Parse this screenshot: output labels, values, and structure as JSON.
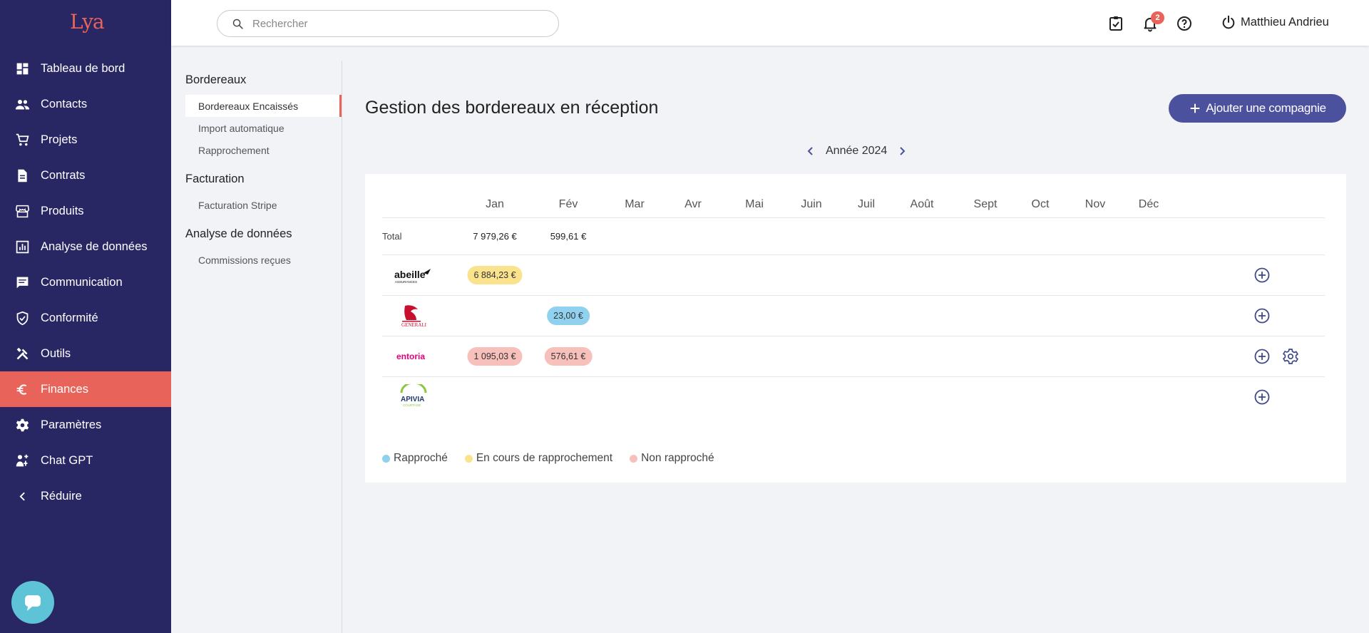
{
  "app": {
    "logo_text": "Lya"
  },
  "sidebar": {
    "items": [
      {
        "label": "Tableau de bord",
        "icon": "dashboard-icon"
      },
      {
        "label": "Contacts",
        "icon": "people-icon"
      },
      {
        "label": "Projets",
        "icon": "cart-icon"
      },
      {
        "label": "Contrats",
        "icon": "document-icon"
      },
      {
        "label": "Produits",
        "icon": "store-icon"
      },
      {
        "label": "Analyse de données",
        "icon": "bar-chart-icon"
      },
      {
        "label": "Communication",
        "icon": "message-icon"
      },
      {
        "label": "Conformité",
        "icon": "shield-check-icon"
      },
      {
        "label": "Outils",
        "icon": "tools-icon"
      },
      {
        "label": "Finances",
        "icon": "euro-icon",
        "active": true
      },
      {
        "label": "Paramètres",
        "icon": "gear-icon"
      },
      {
        "label": "Chat GPT",
        "icon": "robot-icon"
      },
      {
        "label": "Réduire",
        "icon": "chevron-left-icon"
      }
    ]
  },
  "header": {
    "search_placeholder": "Rechercher",
    "notification_count": "2",
    "user_name": "Matthieu Andrieu"
  },
  "submenu": {
    "sections": [
      {
        "title": "Bordereaux",
        "items": [
          {
            "label": "Bordereaux Encaissés",
            "active": true
          },
          {
            "label": "Import automatique"
          },
          {
            "label": "Rapprochement"
          }
        ]
      },
      {
        "title": "Facturation",
        "items": [
          {
            "label": "Facturation Stripe"
          }
        ]
      },
      {
        "title": "Analyse de données",
        "items": [
          {
            "label": "Commissions reçues"
          }
        ]
      }
    ]
  },
  "main": {
    "title": "Gestion des bordereaux en réception",
    "add_button": "Ajouter une compagnie",
    "year_label": "Année 2024",
    "months": [
      "Jan",
      "Fév",
      "Mar",
      "Avr",
      "Mai",
      "Juin",
      "Juil",
      "Août",
      "Sept",
      "Oct",
      "Nov",
      "Déc"
    ],
    "total_label": "Total",
    "totals": [
      "7 979,26 €",
      "599,61 €"
    ],
    "companies": [
      {
        "logo": "abeille",
        "logo_text": "abeille",
        "logo_sub": "ASSURANCES",
        "cells": [
          {
            "month": 0,
            "value": "6 884,23 €",
            "status": "yellow"
          }
        ],
        "settings": false
      },
      {
        "logo": "generali",
        "logo_text": "GENERALI",
        "cells": [
          {
            "month": 1,
            "value": "23,00 €",
            "status": "blue"
          }
        ],
        "settings": false
      },
      {
        "logo": "entoria",
        "logo_text": "entoria",
        "cells": [
          {
            "month": 0,
            "value": "1 095,03 €",
            "status": "pink"
          },
          {
            "month": 1,
            "value": "576,61 €",
            "status": "pink"
          }
        ],
        "settings": true
      },
      {
        "logo": "apivia",
        "logo_text": "APIVIA",
        "logo_sub": "COURTAGE",
        "cells": [],
        "settings": false
      }
    ],
    "legend": [
      {
        "label": "Rapproché",
        "color": "#8fd1ee"
      },
      {
        "label": "En cours de rapprochement",
        "color": "#fbe28c"
      },
      {
        "label": "Non rapproché",
        "color": "#f7c0bb"
      }
    ]
  },
  "colors": {
    "sidebar_bg": "#282663",
    "accent": "#e8645a",
    "button": "#4b519d"
  }
}
